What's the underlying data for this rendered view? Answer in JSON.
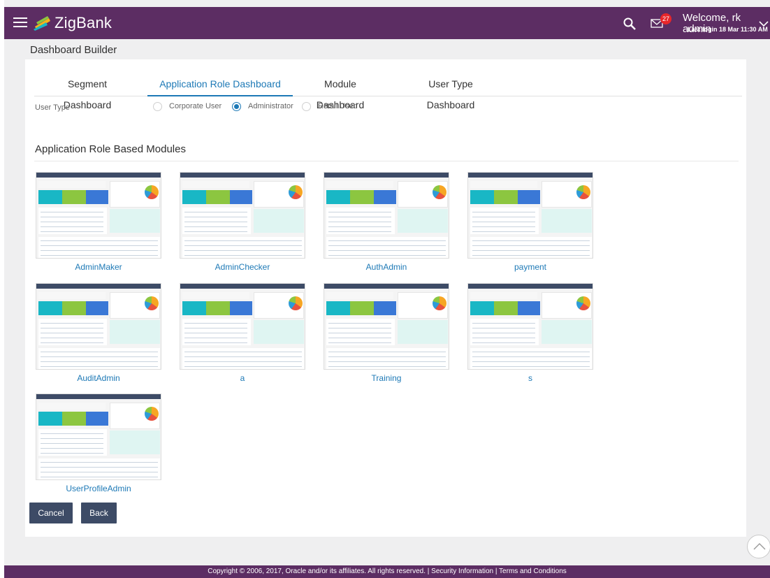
{
  "header": {
    "brand": "ZigBank",
    "notification_count": "27",
    "welcome_text": "Welcome, rk admin",
    "last_login": "Last login 18 Mar 11:30 AM",
    "brand_color": "#5c2d63",
    "icons": [
      "menu-icon",
      "logo-icon",
      "search-icon",
      "mail-icon",
      "chevron-down-icon"
    ]
  },
  "page": {
    "title": "Dashboard Builder"
  },
  "tabs": [
    {
      "label": "Segment Dashboard",
      "active": false
    },
    {
      "label": "Application Role Dashboard",
      "active": true
    },
    {
      "label": "Module Dashboard",
      "active": false
    },
    {
      "label": "User Type Dashboard",
      "active": false
    }
  ],
  "user_type": {
    "label": "User Type",
    "options": [
      {
        "label": "Corporate User",
        "selected": false
      },
      {
        "label": "Administrator",
        "selected": true
      },
      {
        "label": "Retail User",
        "selected": false
      }
    ]
  },
  "section": {
    "title": "Application Role Based Modules",
    "modules": [
      {
        "name": "AdminMaker"
      },
      {
        "name": "AdminChecker"
      },
      {
        "name": "AuthAdmin"
      },
      {
        "name": "payment"
      },
      {
        "name": "AuditAdmin"
      },
      {
        "name": "a"
      },
      {
        "name": "Training"
      },
      {
        "name": "s"
      },
      {
        "name": "UserProfileAdmin"
      }
    ]
  },
  "actions": {
    "cancel": "Cancel",
    "back": "Back"
  },
  "footer": {
    "text": "Copyright © 2006, 2017, Oracle and/or its affiliates. All rights reserved. | Security Information | Terms and Conditions"
  },
  "accent_color": "#1d79b6"
}
